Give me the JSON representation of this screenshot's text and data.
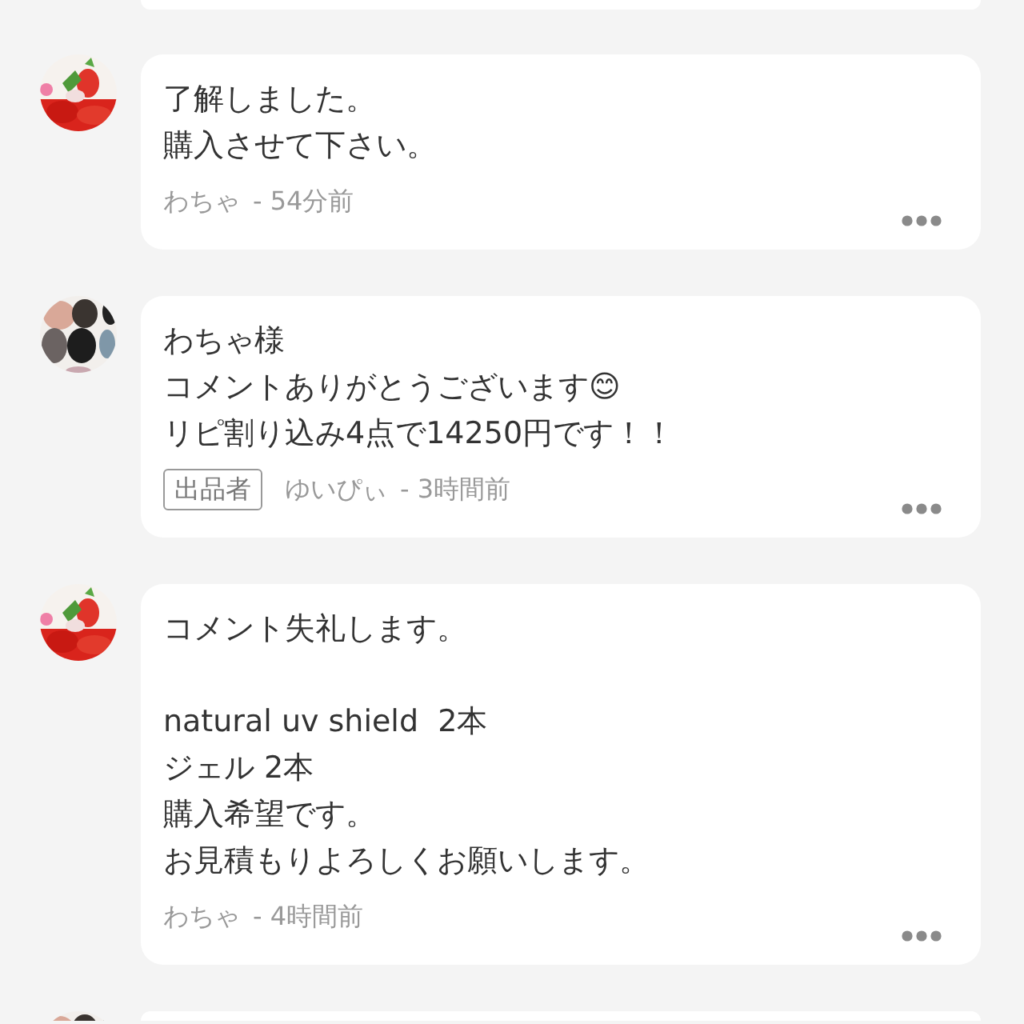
{
  "comments": [
    {
      "paragraphs": [
        [
          "了解しました。",
          "購入させて下さい。"
        ]
      ],
      "author": "わちゃ",
      "time": "- 54分前"
    },
    {
      "paragraphs": [
        [
          "わちゃ様",
          "コメントありがとうございます😊",
          "リピ割り込み4点で14250円です！！"
        ]
      ],
      "badge": "出品者",
      "author": "ゆいぴぃ",
      "time": "- 3時間前"
    },
    {
      "paragraphs": [
        [
          "コメント失礼します。"
        ],
        [
          "natural uv shield  2本",
          "ジェル 2本",
          "購入希望です。",
          "お見積もりよろしくお願いします。"
        ]
      ],
      "author": "わちゃ",
      "time": "- 4時間前"
    }
  ]
}
